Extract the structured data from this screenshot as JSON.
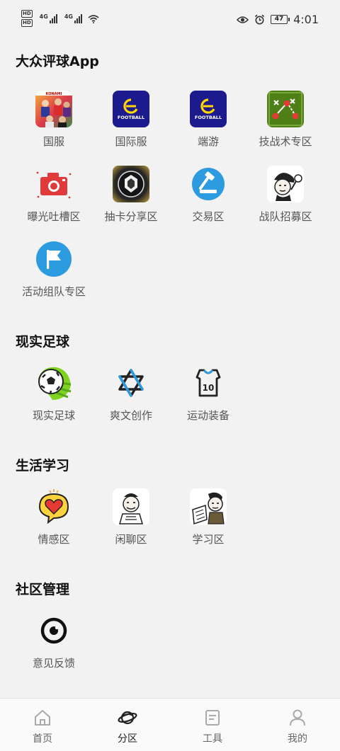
{
  "status_bar": {
    "hd_badge": "HD",
    "network_1": "4G",
    "network_2": "4G",
    "battery": "47",
    "time": "4:01"
  },
  "sections": [
    {
      "title": "大众评球App",
      "items": [
        {
          "label": "国服",
          "icon": "pes-konami-cover-icon"
        },
        {
          "label": "国际服",
          "icon": "efootball-logo-icon"
        },
        {
          "label": "端游",
          "icon": "efootball-logo-icon"
        },
        {
          "label": "技战术专区",
          "icon": "tactics-board-icon"
        },
        {
          "label": "曝光吐槽区",
          "icon": "camera-icon"
        },
        {
          "label": "抽卡分享区",
          "icon": "card-badge-icon"
        },
        {
          "label": "交易区",
          "icon": "gavel-icon"
        },
        {
          "label": "战队招募区",
          "icon": "meme-face-icon"
        },
        {
          "label": "活动组队专区",
          "icon": "flag-icon"
        }
      ]
    },
    {
      "title": "现实足球",
      "items": [
        {
          "label": "现实足球",
          "icon": "soccer-ball-icon"
        },
        {
          "label": "爽文创作",
          "icon": "star-of-david-icon"
        },
        {
          "label": "运动装备",
          "icon": "jersey-icon"
        }
      ]
    },
    {
      "title": "生活学习",
      "items": [
        {
          "label": "情感区",
          "icon": "heart-bubble-icon"
        },
        {
          "label": "闲聊区",
          "icon": "meme-face-icon"
        },
        {
          "label": "学习区",
          "icon": "meme-study-icon"
        }
      ]
    },
    {
      "title": "社区管理",
      "items": [
        {
          "label": "意见反馈",
          "icon": "feedback-ring-icon"
        }
      ]
    }
  ],
  "tiles": {
    "konami_text": "KONAMI",
    "efootball_text": "FOOTBALL",
    "jersey_number": "10"
  },
  "bottom_nav": [
    {
      "label": "首页",
      "icon": "home-icon",
      "active": false
    },
    {
      "label": "分区",
      "icon": "planet-icon",
      "active": true
    },
    {
      "label": "工具",
      "icon": "document-icon",
      "active": false
    },
    {
      "label": "我的",
      "icon": "user-icon",
      "active": false
    }
  ],
  "colors": {
    "background": "#f2f2f2",
    "efootball_blue": "#1c1a8c",
    "camera_red": "#e03a3a",
    "accent_blue": "#2d9be0",
    "tactics_green": "#4f7f17"
  }
}
